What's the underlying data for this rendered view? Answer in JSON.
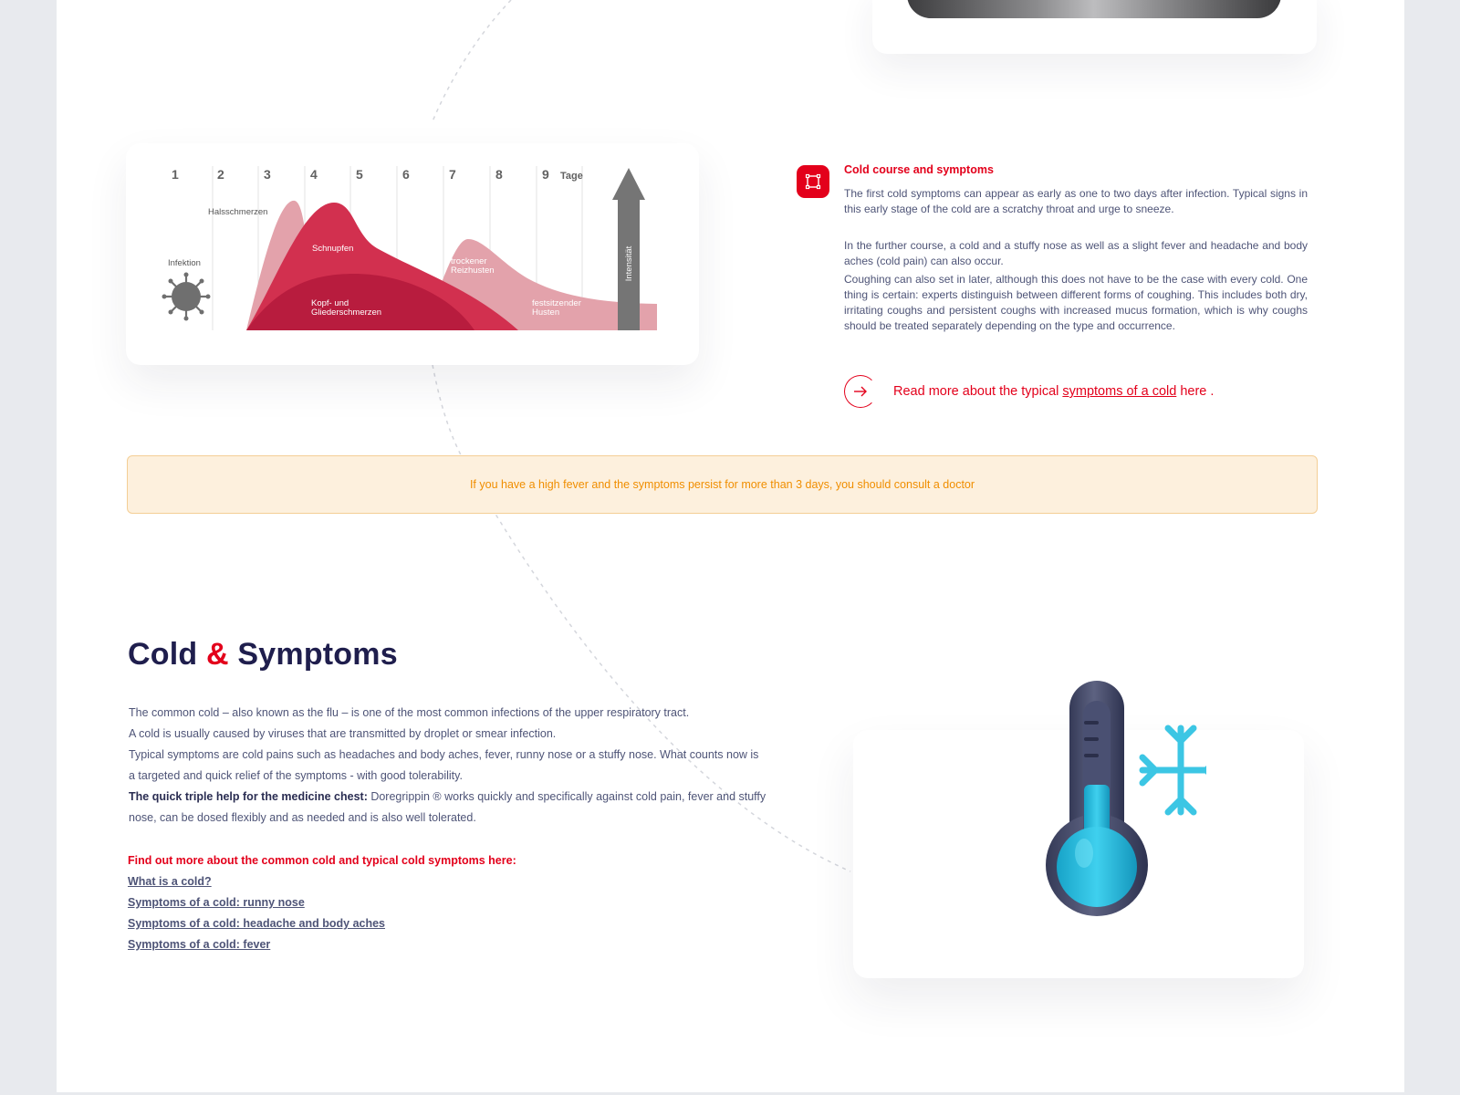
{
  "chart": {
    "day_labels": [
      "1",
      "2",
      "3",
      "4",
      "5",
      "6",
      "7",
      "8",
      "9"
    ],
    "days_unit": "Tage",
    "intensity_label": "Intensität",
    "labels": {
      "infection": "Infektion",
      "sore_throat": "Halsschmerzen",
      "runny_nose": "Schnupfen",
      "dry_cough_line1": "trockener",
      "dry_cough_line2": "Reizhusten",
      "pain_line1": "Kopf- und",
      "pain_line2": "Gliederschmerzen",
      "chesty_cough_line1": "festsitzender",
      "chesty_cough_line2": "Husten"
    },
    "colors": {
      "light": "#e3a2ab",
      "medium": "#d2304f",
      "dark": "#b81c3e",
      "arrow": "#757575",
      "virus": "#6f6f6f"
    }
  },
  "info": {
    "title": "Cold course and symptoms",
    "paragraph1": "The first cold symptoms can appear as early as one to two days after infection. Typical signs in this early stage of the cold are a scratchy throat and urge to sneeze.",
    "paragraph2": "In the further course, a cold and a stuffy nose as well as a slight fever and headache and body aches (cold pain) can also occur.",
    "paragraph3": "Coughing can also set in later, although this does not have to be the case with every cold. One thing is certain: experts distinguish between different forms of coughing. This includes both dry, irritating coughs and persistent coughs with increased mucus formation, which is why coughs should be treated separately depending on the type and occurrence.",
    "read_more_prefix": "Read more about the typical ",
    "read_more_link": "symptoms of a cold",
    "read_more_suffix": " here ."
  },
  "notice": {
    "text": "If you have a high fever and the symptoms persist for more than 3 days, you should consult a doctor"
  },
  "section": {
    "title_part1": "Cold ",
    "title_amp": "&",
    "title_part2": " Symptoms",
    "line1": "The common cold – also known as the flu – is one of the most common infections of the upper respiratory tract.",
    "line2": "A cold is usually caused by viruses that are transmitted by droplet or smear infection.",
    "line3": "Typical symptoms are cold pains such as headaches and body aches, fever, runny nose or a stuffy nose. What counts now is a targeted and quick relief of the symptoms - with good tolerability.",
    "bold_lead": "The quick triple help for the medicine chest:",
    "line4": " Doregrippin ® works quickly and specifically against cold pain, fever and stuffy nose, can be dosed flexibly and as needed and is also well tolerated.",
    "links_heading": "Find out more about the common cold and typical cold symptoms here:",
    "links": [
      "What is a cold?",
      "Symptoms of a cold: runny nose",
      "Symptoms of a cold: headache and body aches",
      "Symptoms of a cold: fever"
    ]
  },
  "colors": {
    "brand_red": "#e3001b",
    "navy": "#1f1e4d",
    "text": "#4e5477",
    "notice_bg": "#fdf0dd",
    "notice_text": "#f08e00",
    "thermo_blue": "#1fb6d8"
  },
  "icons": {
    "info_icon": "frame-square-icon",
    "read_more_icon": "arrow-right-circle-icon",
    "illustration": "thermometer-snowflake-icon"
  }
}
